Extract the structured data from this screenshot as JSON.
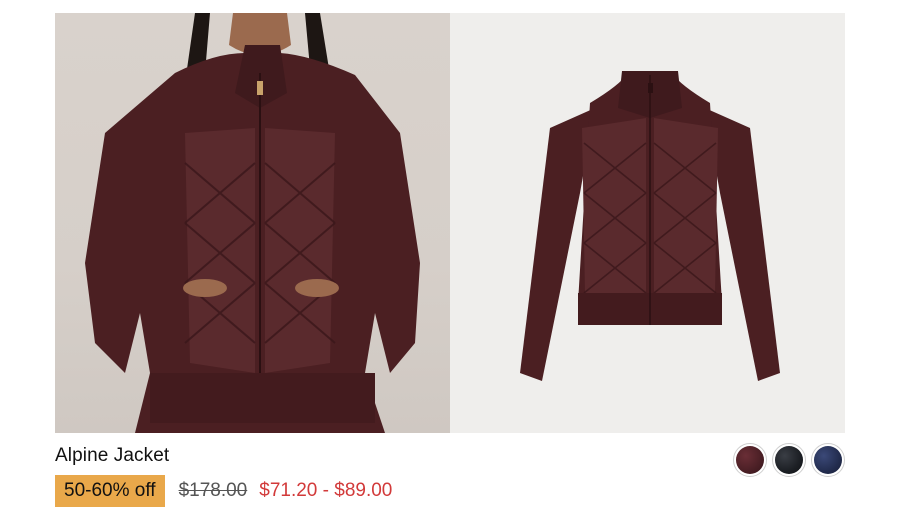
{
  "product": {
    "title": "Alpine Jacket",
    "discount_badge": "50-60% off",
    "original_price": "$178.00",
    "sale_price_range": "$71.20 - $89.00"
  },
  "images": [
    {
      "name": "model-photo",
      "kind": "on-model"
    },
    {
      "name": "flat-photo",
      "kind": "flat-lay"
    }
  ],
  "swatches": [
    {
      "name": "swatch-burgundy",
      "color": "#4a1f25"
    },
    {
      "name": "swatch-black",
      "color": "#1c1f24"
    },
    {
      "name": "swatch-navy",
      "color": "#232d4f"
    }
  ],
  "colors": {
    "badge": "#e9a84a",
    "sale_price": "#d23a3a",
    "jacket": "#4b1f22"
  }
}
